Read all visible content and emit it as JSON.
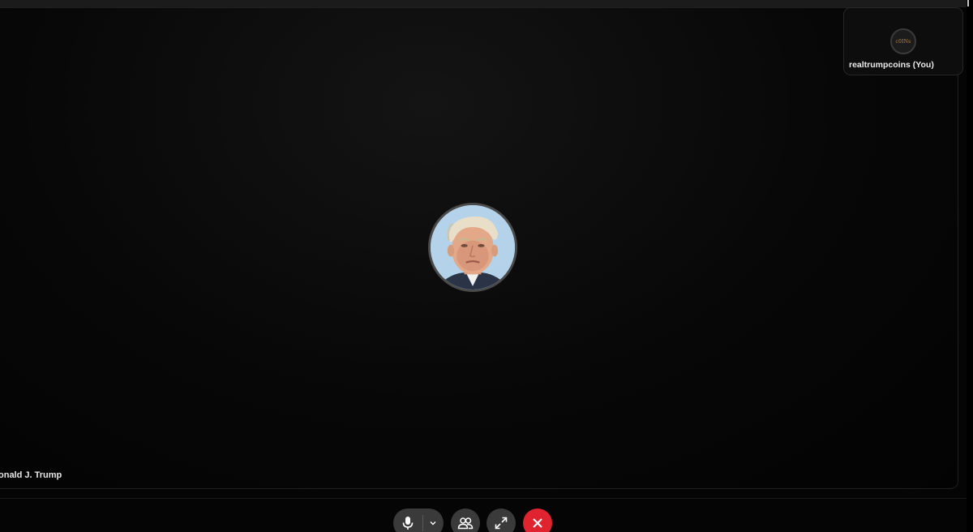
{
  "call": {
    "main_participant": {
      "name": "onald J. Trump",
      "avatar_icon": "participant-photo"
    },
    "self_participant": {
      "name": "realtrumpcoins (You)",
      "avatar_text": "c0INs",
      "avatar_icon": "coin-logo"
    }
  },
  "controls": {
    "mic": {
      "icon": "microphone-icon",
      "dropdown_icon": "chevron-down-icon"
    },
    "participants": {
      "icon": "people-icon"
    },
    "fullscreen": {
      "icon": "expand-icon"
    },
    "leave": {
      "icon": "close-icon",
      "color": "#e0242f"
    }
  },
  "colors": {
    "background": "#050505",
    "button": "#3a3a3a",
    "leave": "#e0242f",
    "text": "#ececec"
  }
}
